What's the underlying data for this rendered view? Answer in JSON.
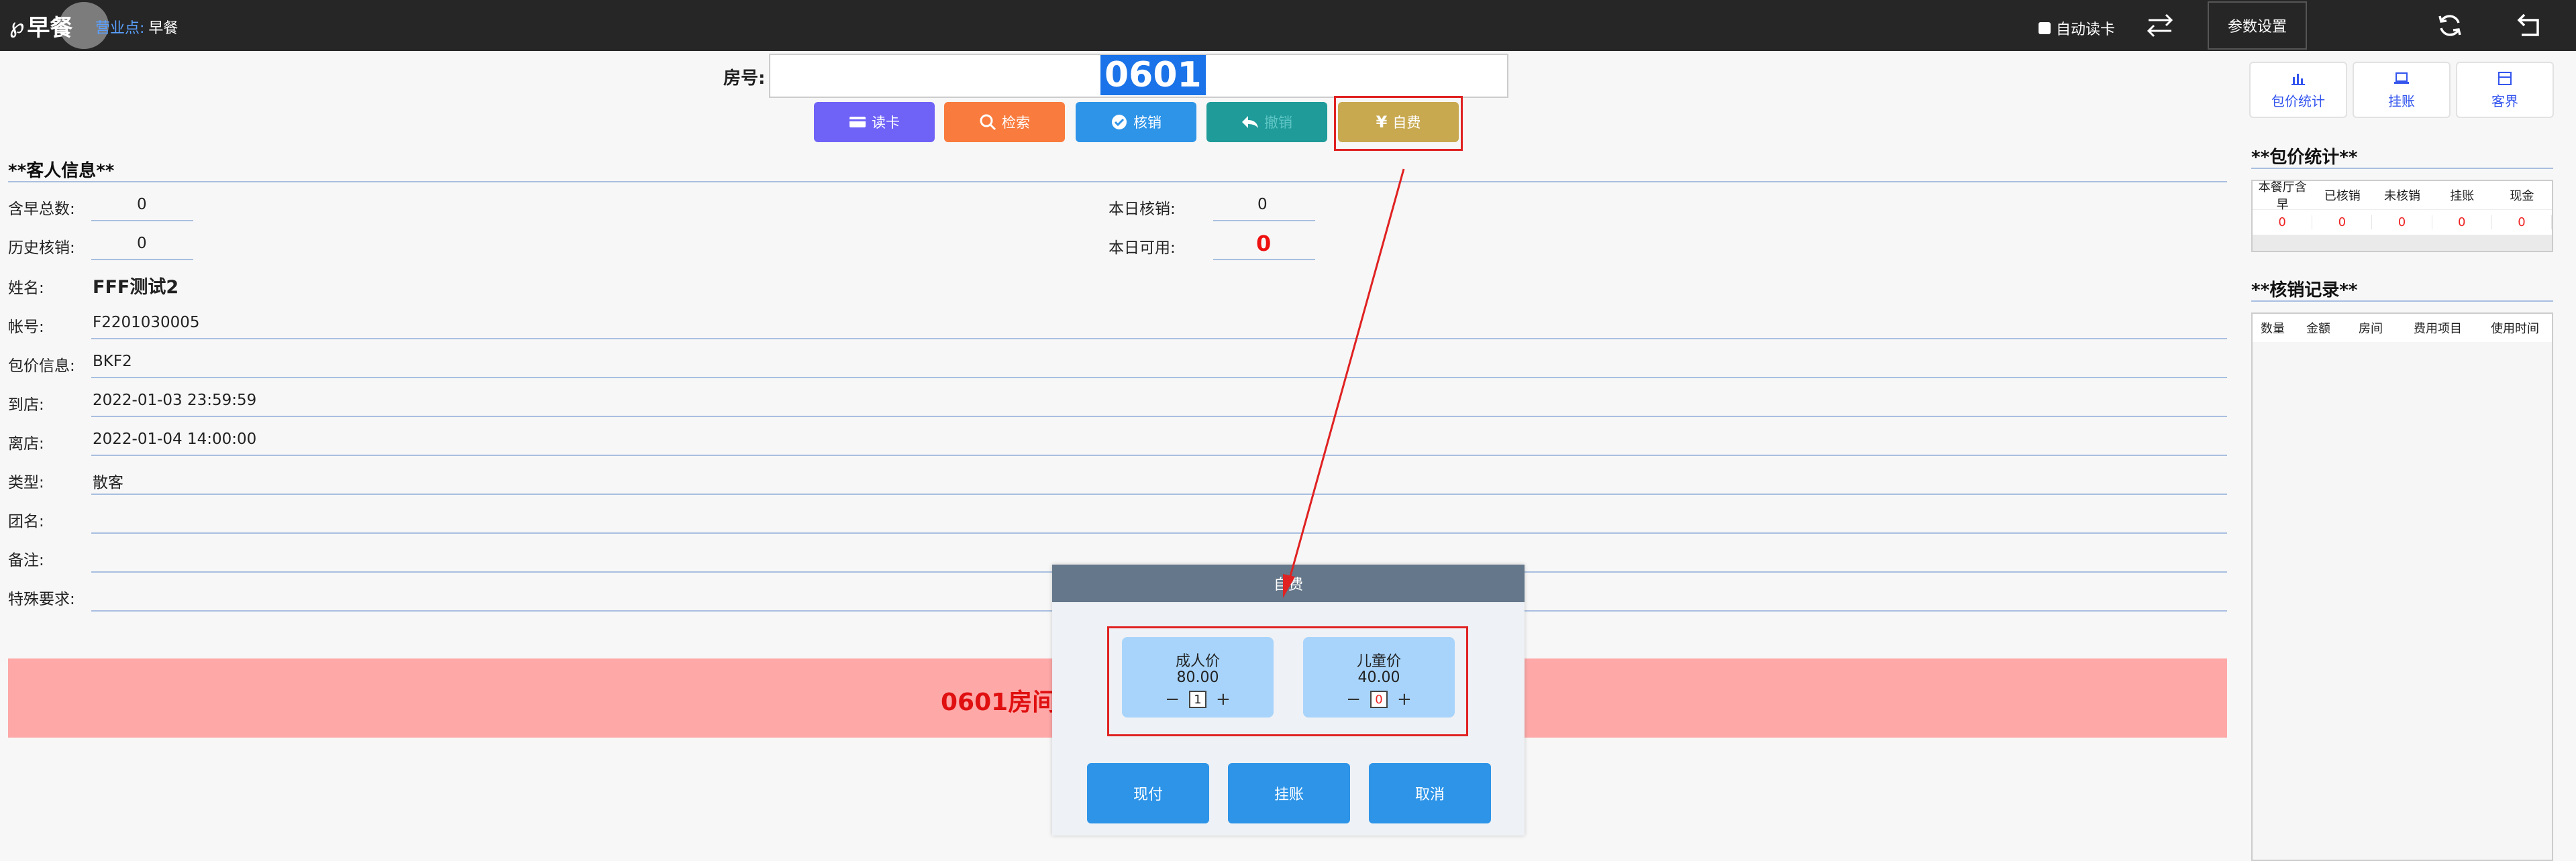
{
  "header": {
    "logo_glyph": "℘",
    "app_name": "早餐",
    "outlet_label": "营业点:",
    "outlet_value": "早餐",
    "auto_read_label": "自动读卡",
    "settings_label": "参数设置",
    "icons": [
      "swap-icon",
      "refresh-icon",
      "back-icon"
    ]
  },
  "room": {
    "label": "房号:",
    "value": "0601"
  },
  "actions": {
    "read_card": "读卡",
    "search": "检索",
    "verify": "核销",
    "undo": "撤销",
    "self_pay": "自费"
  },
  "guest": {
    "section_title": "**客人信息**",
    "total_breakfast_label": "含早总数:",
    "total_breakfast": "0",
    "history_label": "历史核销:",
    "history": "0",
    "today_verified_label": "本日核销:",
    "today_verified": "0",
    "today_available_label": "本日可用:",
    "today_available": "0",
    "name_label": "姓名:",
    "name": "FFF测试2",
    "account_label": "帐号:",
    "account": "F2201030005",
    "package_label": "包价信息:",
    "package": "BKF2",
    "arrival_label": "到店:",
    "arrival": "2022-01-03 23:59:59",
    "departure_label": "离店:",
    "departure": "2022-01-04 14:00:00",
    "type_label": "类型:",
    "type": "散客",
    "group_label": "团名:",
    "remark_label": "备注:",
    "special_label": "特殊要求:"
  },
  "banner": {
    "text": "0601房间"
  },
  "right": {
    "pkg_stats_btn": "包价统计",
    "charge_btn": "挂账",
    "guest_btn": "客界",
    "pkg_title": "**包价统计**",
    "pkg_columns": [
      "本餐厅含早",
      "已核销",
      "未核销",
      "挂账",
      "现金"
    ],
    "pkg_values": [
      "0",
      "0",
      "0",
      "0",
      "0"
    ],
    "records_title": "**核销记录**",
    "record_columns": [
      "数量",
      "金额",
      "房间",
      "费用项目",
      "使用时间"
    ]
  },
  "dialog": {
    "title": "自费",
    "adult_label": "成人价",
    "adult_price": "80.00",
    "adult_qty": "1",
    "child_label": "儿童价",
    "child_price": "40.00",
    "child_qty": "0",
    "minus": "−",
    "plus": "+",
    "cash_btn": "现付",
    "charge_btn": "挂账",
    "cancel_btn": "取消"
  },
  "colors": {
    "topbar": "#262626",
    "read_card": "#6f63f7",
    "search": "#f97b3d",
    "verify": "#2d94e8",
    "undo": "#1f9b9a",
    "self_pay": "#c8a950",
    "banner": "#fea8a8",
    "highlight": "#e02222"
  }
}
